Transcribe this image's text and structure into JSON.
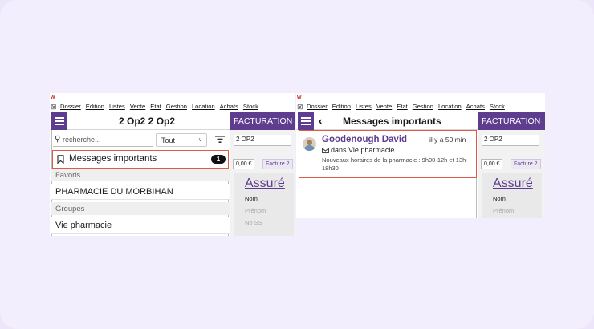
{
  "menubar": {
    "items": [
      "Dossier",
      "Edition",
      "Listes",
      "Vente",
      "Etat",
      "Gestion",
      "Location",
      "Achats",
      "Stock"
    ]
  },
  "left_panel": {
    "title": "2 Op2 2 Op2",
    "search_placeholder": "recherche...",
    "filter_value": "Tout",
    "messages": {
      "label": "Messages importants",
      "count": "1"
    },
    "sections": [
      {
        "header": "Favoris",
        "items": [
          "PHARMACIE DU MORBIHAN"
        ]
      },
      {
        "header": "Groupes",
        "items": [
          "Vie pharmacie"
        ]
      }
    ]
  },
  "detail_panel": {
    "title": "Messages importants",
    "message": {
      "sender": "Goodenough David",
      "time": "il y a 50 min",
      "group": "dans Vie pharmacie",
      "preview": "Nouveaux horaires de la pharmacie : 9h00-12h et 13h-18h30"
    }
  },
  "facturation": {
    "title": "FACTURATION",
    "field": "2 OP2",
    "tabs": [
      "0,00 €",
      "Facture 2"
    ],
    "section": "Assuré",
    "fields": [
      "Nom",
      "Prénom",
      "No SS"
    ]
  },
  "colors": {
    "accent": "#5e3d8f",
    "highlight": "#e05a4a"
  }
}
